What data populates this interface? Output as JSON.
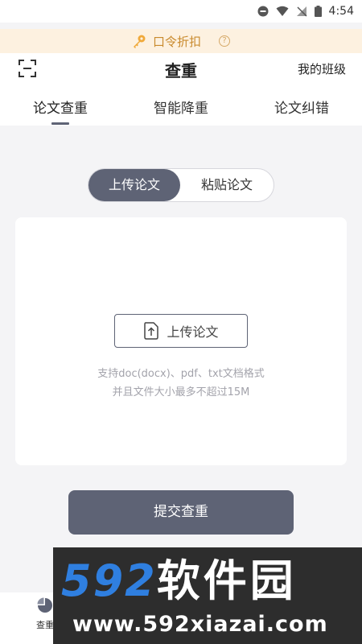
{
  "status_bar": {
    "time": "4:54"
  },
  "promo": {
    "label": "口令折扣",
    "help_glyph": "?"
  },
  "header": {
    "title": "查重",
    "right_link": "我的班级"
  },
  "tabs": [
    {
      "label": "论文查重",
      "active": true
    },
    {
      "label": "智能降重",
      "active": false
    },
    {
      "label": "论文纠错",
      "active": false
    }
  ],
  "segment": {
    "options": [
      "上传论文",
      "粘贴论文"
    ],
    "selected": "上传论文"
  },
  "upload": {
    "button_label": "上传论文",
    "hint_line1": "支持doc(docx)、pdf、txt文档格式",
    "hint_line2": "并且文件大小最多不超过15M"
  },
  "submit": {
    "label": "提交查重"
  },
  "bottom_nav": {
    "items": [
      {
        "label": "查重",
        "icon": "pie-chart-icon"
      }
    ]
  },
  "watermark": {
    "number": "592",
    "name": "软件园",
    "url": "www.592xiazai.com"
  },
  "colors": {
    "accent": "#5e6375",
    "promo_bg": "#fdf1e0",
    "promo_text": "#c98a2d",
    "page_bg": "#f4f4f6"
  }
}
